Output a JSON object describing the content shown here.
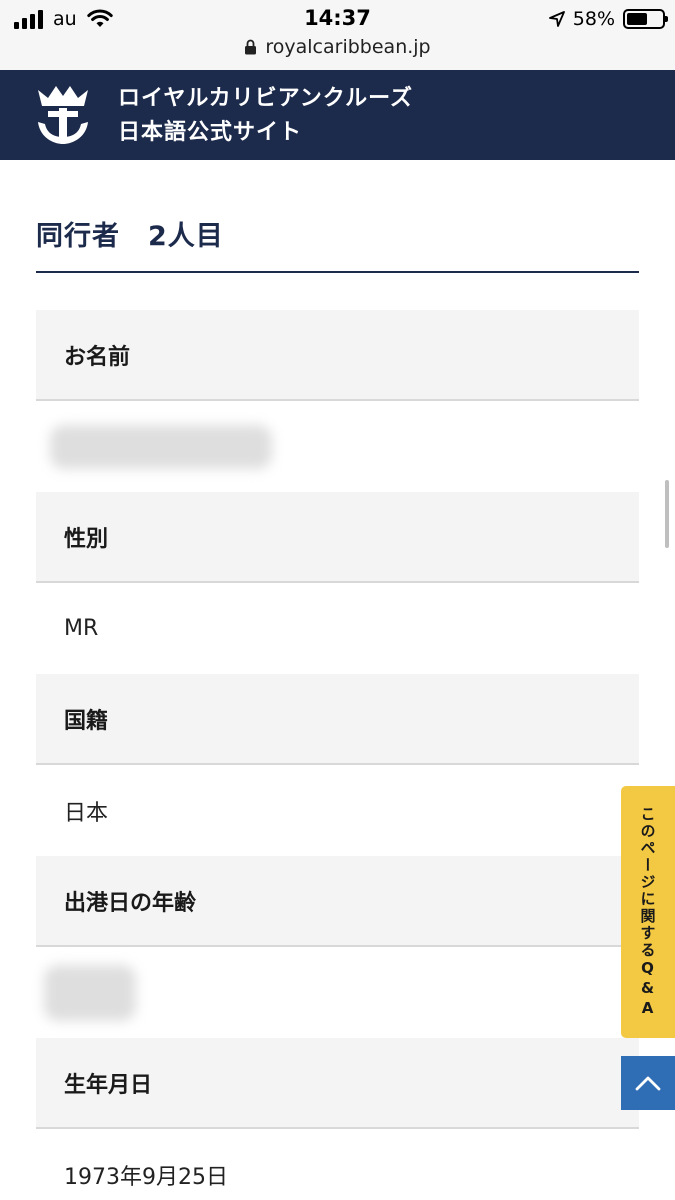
{
  "status_bar": {
    "carrier": "au",
    "time": "14:37",
    "battery_percent": "58%",
    "battery_level": 0.58,
    "url": "royalcaribbean.jp",
    "icons": [
      "signal-icon",
      "wifi-icon",
      "location-arrow-icon",
      "battery-icon",
      "lock-icon"
    ]
  },
  "header": {
    "title_line1": "ロイヤルカリビアンクルーズ",
    "title_line2": "日本語公式サイト",
    "logo_icon": "crown-anchor-logo"
  },
  "section": {
    "title": "同行者　2人目"
  },
  "fields": [
    {
      "label": "お名前",
      "value": ""
    },
    {
      "label": "性別",
      "value": "MR"
    },
    {
      "label": "国籍",
      "value": "日本"
    },
    {
      "label": "出港日の年齢",
      "value": ""
    },
    {
      "label": "生年月日",
      "value": "1973年9月25日"
    }
  ],
  "side_tab": {
    "label": "このページに関するQ&A"
  },
  "colors": {
    "navy": "#1c2a4b",
    "qa_yellow": "#f3c843",
    "top_button_blue": "#2f6db5",
    "label_bg": "#f4f4f4"
  }
}
